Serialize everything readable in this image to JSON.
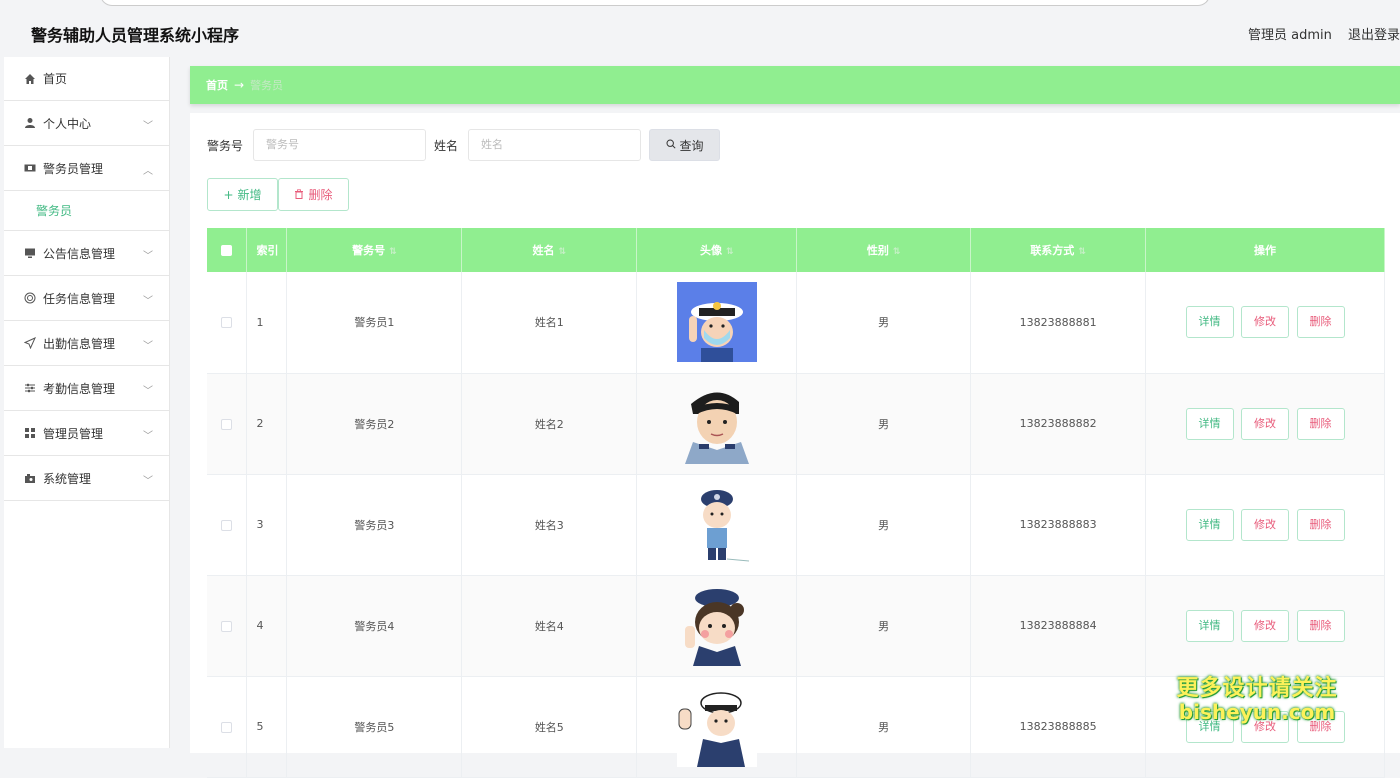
{
  "header": {
    "title": "警务辅助人员管理系统小程序",
    "admin_label": "管理员 admin",
    "logout": "退出登录"
  },
  "sidebar": {
    "items": [
      {
        "label": "首页",
        "icon": "home-icon"
      },
      {
        "label": "个人中心",
        "icon": "user-icon"
      },
      {
        "label": "警务员管理",
        "icon": "ticket-icon",
        "expanded": true,
        "sub": "警务员"
      },
      {
        "label": "公告信息管理",
        "icon": "monitor-icon"
      },
      {
        "label": "任务信息管理",
        "icon": "target-icon"
      },
      {
        "label": "出勤信息管理",
        "icon": "send-icon"
      },
      {
        "label": "考勤信息管理",
        "icon": "sliders-icon"
      },
      {
        "label": "管理员管理",
        "icon": "grid-icon"
      },
      {
        "label": "系统管理",
        "icon": "camera-icon"
      }
    ]
  },
  "breadcrumb": {
    "home": "首页",
    "arrow": "→",
    "current": "警务员"
  },
  "search": {
    "field1_label": "警务号",
    "field1_placeholder": "警务号",
    "field2_label": "姓名",
    "field2_placeholder": "姓名",
    "button": "查询"
  },
  "actions": {
    "add": "新增",
    "delete": "删除"
  },
  "table": {
    "headers": [
      "索引",
      "警务号",
      "姓名",
      "头像",
      "性别",
      "联系方式",
      "操作"
    ],
    "rows": [
      {
        "idx": "1",
        "no": "警务员1",
        "name": "姓名1",
        "gender": "男",
        "phone": "13823888881"
      },
      {
        "idx": "2",
        "no": "警务员2",
        "name": "姓名2",
        "gender": "男",
        "phone": "13823888882"
      },
      {
        "idx": "3",
        "no": "警务员3",
        "name": "姓名3",
        "gender": "男",
        "phone": "13823888883"
      },
      {
        "idx": "4",
        "no": "警务员4",
        "name": "姓名4",
        "gender": "男",
        "phone": "13823888884"
      },
      {
        "idx": "5",
        "no": "警务员5",
        "name": "姓名5",
        "gender": "男",
        "phone": "13823888885"
      }
    ],
    "ops": {
      "detail": "详情",
      "edit": "修改",
      "delete": "删除"
    }
  },
  "watermark": {
    "line1": "更多设计请关注",
    "line2": "bisheyun.com"
  },
  "colors": {
    "accent": "#90ee90",
    "primary": "#42b983",
    "danger": "#e85b7a"
  }
}
